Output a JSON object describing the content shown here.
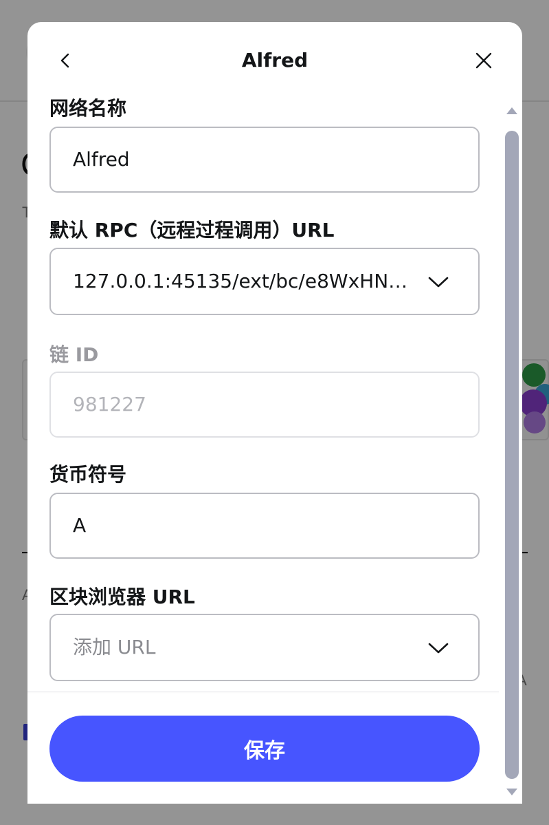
{
  "modal": {
    "title": "Alfred",
    "back_icon": "chevron-left-icon",
    "close_icon": "close-icon"
  },
  "fields": {
    "network_name": {
      "label": "网络名称",
      "value": "Alfred"
    },
    "rpc_url": {
      "label": "默认 RPC（远程过程调用）URL",
      "value": "127.0.0.1:45135/ext/bc/e8WxHNh..."
    },
    "chain_id": {
      "label": "链 ID",
      "value": "981227"
    },
    "currency_symbol": {
      "label": "货币符号",
      "value": "A"
    },
    "explorer_url": {
      "label": "区块浏览器 URL",
      "placeholder": "添加 URL"
    }
  },
  "footer": {
    "save_label": "保存"
  },
  "colors": {
    "accent": "#4755ff",
    "scrollbar": "#a3a7b8",
    "border": "#bbbcc2"
  }
}
